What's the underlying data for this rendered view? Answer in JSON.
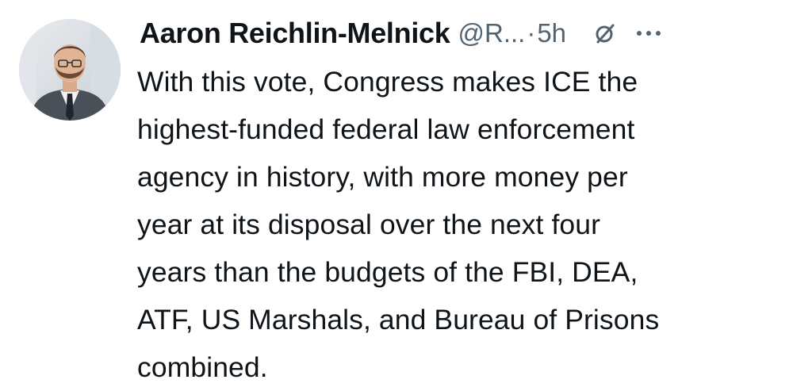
{
  "tweet": {
    "author": {
      "name": "Aaron Reichlin-Melnick",
      "handle": "@R...",
      "separator": "·",
      "time": "5h",
      "avatar": "profile-photo"
    },
    "icons": {
      "grok": "slashed-circle-icon",
      "more": "more-dots-icon"
    },
    "text_lines": [
      "With this vote, Congress makes ICE the",
      "highest-funded federal law enforcement",
      "agency in history, with more money per",
      "year at its disposal over the next four",
      "years than the budgets of the FBI, DEA,",
      "ATF, US Marshals, and Bureau of Prisons",
      "combined."
    ]
  },
  "colors": {
    "text": "#0f1419",
    "secondary": "#536471",
    "background": "#ffffff"
  }
}
